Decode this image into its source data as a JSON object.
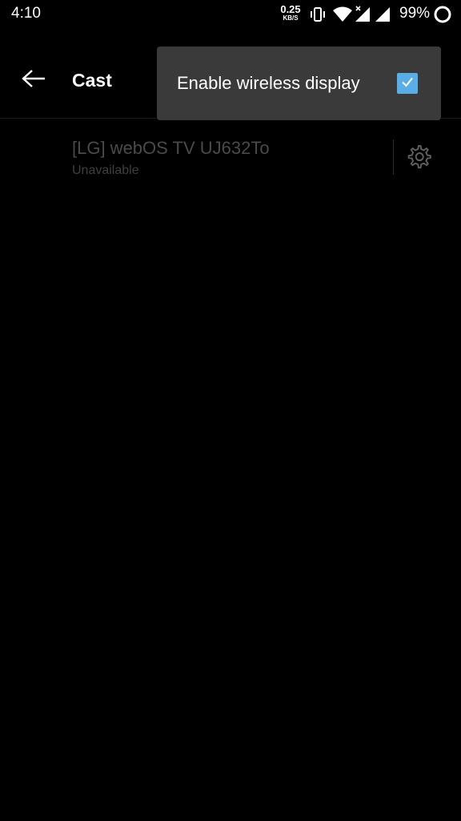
{
  "status_bar": {
    "time": "4:10",
    "net_speed_value": "0.25",
    "net_speed_unit": "KB/S",
    "battery_percent": "99%",
    "icons": [
      "vibrate-icon",
      "wifi-icon",
      "signal-x-icon",
      "signal-icon",
      "battery-icon"
    ]
  },
  "toolbar": {
    "title": "Cast",
    "back_icon": "arrow-left-icon"
  },
  "devices": [
    {
      "name": "[LG] webOS TV UJ632To",
      "status": "Unavailable",
      "settings_icon": "gear-icon"
    }
  ],
  "overflow_menu": {
    "items": [
      {
        "label": "Enable wireless display",
        "checked": true
      }
    ]
  },
  "colors": {
    "background": "#000000",
    "menu_background": "#3a3a3a",
    "checkbox_accent": "#5aaee8",
    "disabled_text": "#4a4a4a"
  }
}
